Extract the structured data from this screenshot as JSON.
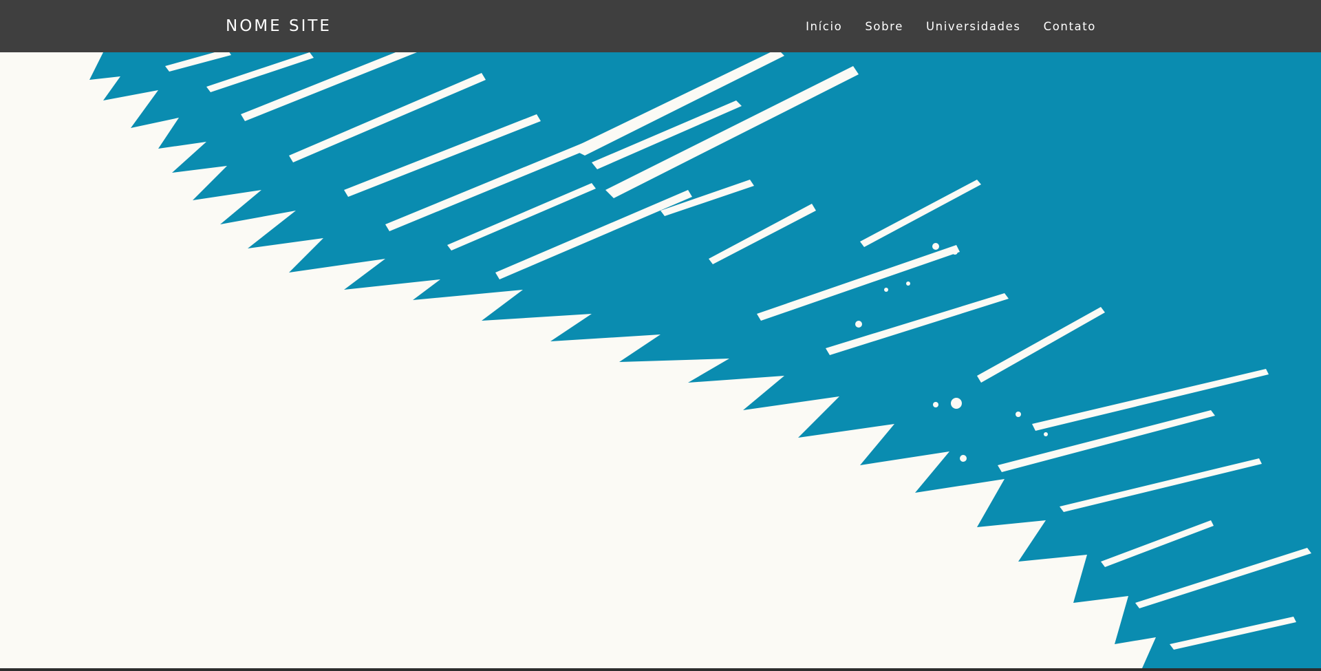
{
  "header": {
    "brand": "NOME SITE",
    "nav": [
      {
        "label": "Início"
      },
      {
        "label": "Sobre"
      },
      {
        "label": "Universidades"
      },
      {
        "label": "Contato"
      }
    ]
  },
  "hero": {
    "description": "abstract white brush strokes on teal background",
    "colors": {
      "background": "#0a8cb0",
      "paint": "#fbfaf5"
    }
  },
  "colors": {
    "navbar": "#3f3f3f",
    "nav_text": "#ffffff"
  }
}
